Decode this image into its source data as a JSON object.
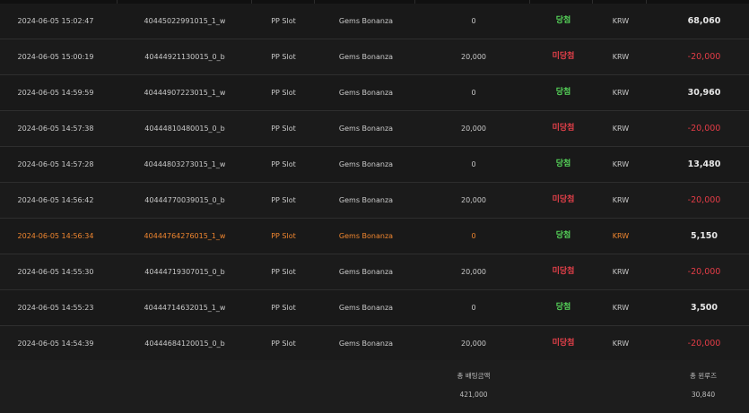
{
  "colors": {
    "background": "#191919",
    "win_text": "#56d65a",
    "lose_text": "#e5404a",
    "negative_amount": "#e23c46",
    "highlight_row": "#f0862f"
  },
  "rows": [
    {
      "datetime": "2024-06-05 15:02:47",
      "bet_id": "40445022991015_1_w",
      "game_type": "PP Slot",
      "game_name": "Gems Bonanza",
      "bet_amount": "0",
      "result": "당첨",
      "currency": "KRW",
      "win_amount": "68,060"
    },
    {
      "datetime": "2024-06-05 15:00:19",
      "bet_id": "40444921130015_0_b",
      "game_type": "PP Slot",
      "game_name": "Gems Bonanza",
      "bet_amount": "20,000",
      "result": "미당첨",
      "currency": "KRW",
      "win_amount": "-20,000"
    },
    {
      "datetime": "2024-06-05 14:59:59",
      "bet_id": "40444907223015_1_w",
      "game_type": "PP Slot",
      "game_name": "Gems Bonanza",
      "bet_amount": "0",
      "result": "당첨",
      "currency": "KRW",
      "win_amount": "30,960"
    },
    {
      "datetime": "2024-06-05 14:57:38",
      "bet_id": "40444810480015_0_b",
      "game_type": "PP Slot",
      "game_name": "Gems Bonanza",
      "bet_amount": "20,000",
      "result": "미당첨",
      "currency": "KRW",
      "win_amount": "-20,000"
    },
    {
      "datetime": "2024-06-05 14:57:28",
      "bet_id": "40444803273015_1_w",
      "game_type": "PP Slot",
      "game_name": "Gems Bonanza",
      "bet_amount": "0",
      "result": "당첨",
      "currency": "KRW",
      "win_amount": "13,480"
    },
    {
      "datetime": "2024-06-05 14:56:42",
      "bet_id": "40444770039015_0_b",
      "game_type": "PP Slot",
      "game_name": "Gems Bonanza",
      "bet_amount": "20,000",
      "result": "미당첨",
      "currency": "KRW",
      "win_amount": "-20,000"
    },
    {
      "datetime": "2024-06-05 14:56:34",
      "bet_id": "40444764276015_1_w",
      "game_type": "PP Slot",
      "game_name": "Gems Bonanza",
      "bet_amount": "0",
      "result": "당첨",
      "currency": "KRW",
      "win_amount": "5,150"
    },
    {
      "datetime": "2024-06-05 14:55:30",
      "bet_id": "40444719307015_0_b",
      "game_type": "PP Slot",
      "game_name": "Gems Bonanza",
      "bet_amount": "20,000",
      "result": "미당첨",
      "currency": "KRW",
      "win_amount": "-20,000"
    },
    {
      "datetime": "2024-06-05 14:55:23",
      "bet_id": "40444714632015_1_w",
      "game_type": "PP Slot",
      "game_name": "Gems Bonanza",
      "bet_amount": "0",
      "result": "당첨",
      "currency": "KRW",
      "win_amount": "3,500"
    },
    {
      "datetime": "2024-06-05 14:54:39",
      "bet_id": "40444684120015_0_b",
      "game_type": "PP Slot",
      "game_name": "Gems Bonanza",
      "bet_amount": "20,000",
      "result": "미당첨",
      "currency": "KRW",
      "win_amount": "-20,000"
    }
  ],
  "summary": {
    "total_bet_label": "총 배팅금액",
    "total_bet_value": "421,000",
    "total_win_label": "총 윈루즈",
    "total_win_value": "30,840"
  }
}
